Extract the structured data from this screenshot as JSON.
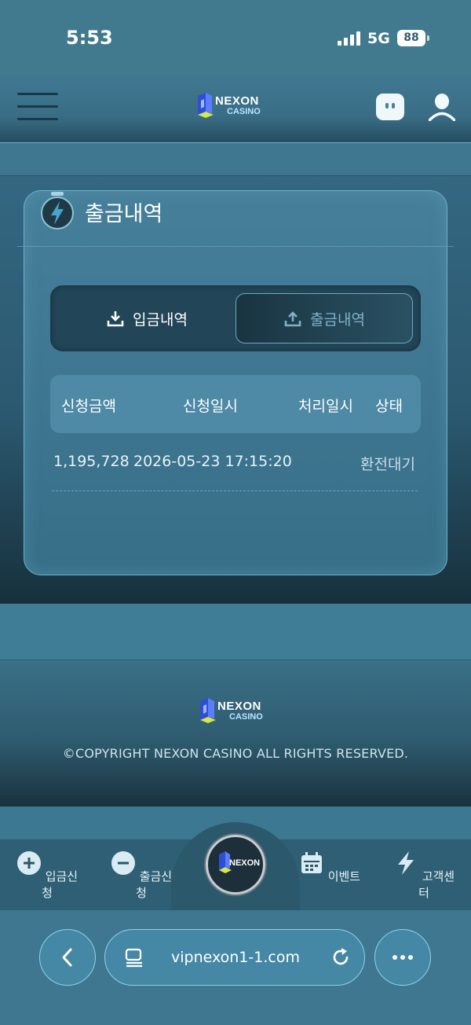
{
  "status_bar": {
    "time": "5:53",
    "network": "5G",
    "battery": "88"
  },
  "header": {
    "logo_text": "NEXON",
    "logo_sub": "CASINO"
  },
  "panel": {
    "title": "출금내역"
  },
  "tabs": [
    {
      "label": "입금내역",
      "active": false
    },
    {
      "label": "출금내역",
      "active": true
    }
  ],
  "table": {
    "headers": [
      "신청금액",
      "신청일시",
      "처리일시",
      "상태"
    ],
    "rows": [
      {
        "amount": "1,195,728",
        "requested_at": "2026-05-23 17:15:20",
        "processed_at": "",
        "status": "환전대기"
      }
    ]
  },
  "footer": {
    "logo_text": "NEXON",
    "logo_sub": "CASINO",
    "copyright": "©COPYRIGHT NEXON CASINO ALL RIGHTS RESERVED."
  },
  "bottom_nav": {
    "items": [
      {
        "label": "입금신청",
        "icon": "plus-circle-icon"
      },
      {
        "label": "출금신청",
        "icon": "minus-circle-icon"
      },
      {
        "label": "",
        "icon": "nexon-home-logo-icon"
      },
      {
        "label": "이벤트",
        "icon": "calendar-icon"
      },
      {
        "label": "고객센터",
        "icon": "lightning-icon"
      }
    ],
    "home_logo_text": "NEXON"
  },
  "browser": {
    "url": "vipnexon1-1.com"
  },
  "colors": {
    "accent": "#8fd2e8",
    "background": "#3f7690",
    "panel": "#467f9a"
  }
}
